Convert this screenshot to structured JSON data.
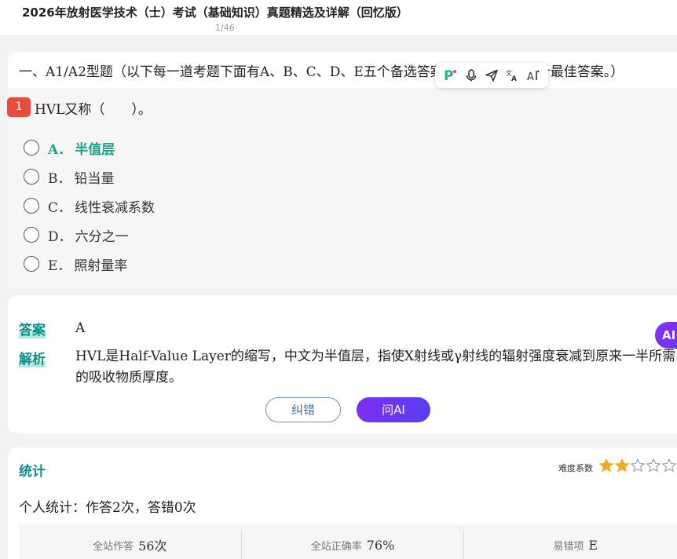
{
  "header": {
    "title": "2026年放射医学技术（士）考试（基础知识）真题精选及详解（回忆版）",
    "page_indicator": "1/46"
  },
  "section": {
    "title": "一、A1/A2型题（以下每一道考题下面有A、B、C、D、E五个备选答案。请从中选择一个最佳答案。）"
  },
  "floating_toolbar": {
    "icons": [
      "logo-icon",
      "microphone-icon",
      "send-icon",
      "translate-icon",
      "text-ai-icon"
    ]
  },
  "question": {
    "number": "1",
    "text": "HVL又称（　　）。",
    "options": [
      {
        "letter": "A．",
        "text": "半值层",
        "correct": true
      },
      {
        "letter": "B．",
        "text": "铅当量",
        "correct": false
      },
      {
        "letter": "C．",
        "text": "线性衰减系数",
        "correct": false
      },
      {
        "letter": "D．",
        "text": "六分之一",
        "correct": false
      },
      {
        "letter": "E．",
        "text": "照射量率",
        "correct": false
      }
    ]
  },
  "answer": {
    "answer_label": "答案",
    "answer_value": "A",
    "explain_label": "解析",
    "explain_text": "HVL是Half-Value Layer的缩写，中文为半值层，指使X射线或γ射线的辐射强度衰减到原来一半所需的吸收物质厚度。",
    "btn_correct": "纠错",
    "btn_ai": "问AI"
  },
  "ai_bubble": "AI",
  "stats": {
    "title": "统计",
    "difficulty_label": "难度系数",
    "difficulty_rating": 2,
    "difficulty_max": 5,
    "personal": "个人统计：作答2次，答错0次",
    "cells": [
      {
        "key": "全站作答",
        "value": "56次"
      },
      {
        "key": "全站正确率",
        "value": "76%"
      },
      {
        "key": "易错项",
        "value": "E"
      }
    ]
  },
  "colors": {
    "accent_teal": "#0e8f84",
    "correct_green": "#18a58a",
    "question_badge": "#e74c3c",
    "ai_purple": "#7b2ff2",
    "star_gold": "#f5a623"
  }
}
